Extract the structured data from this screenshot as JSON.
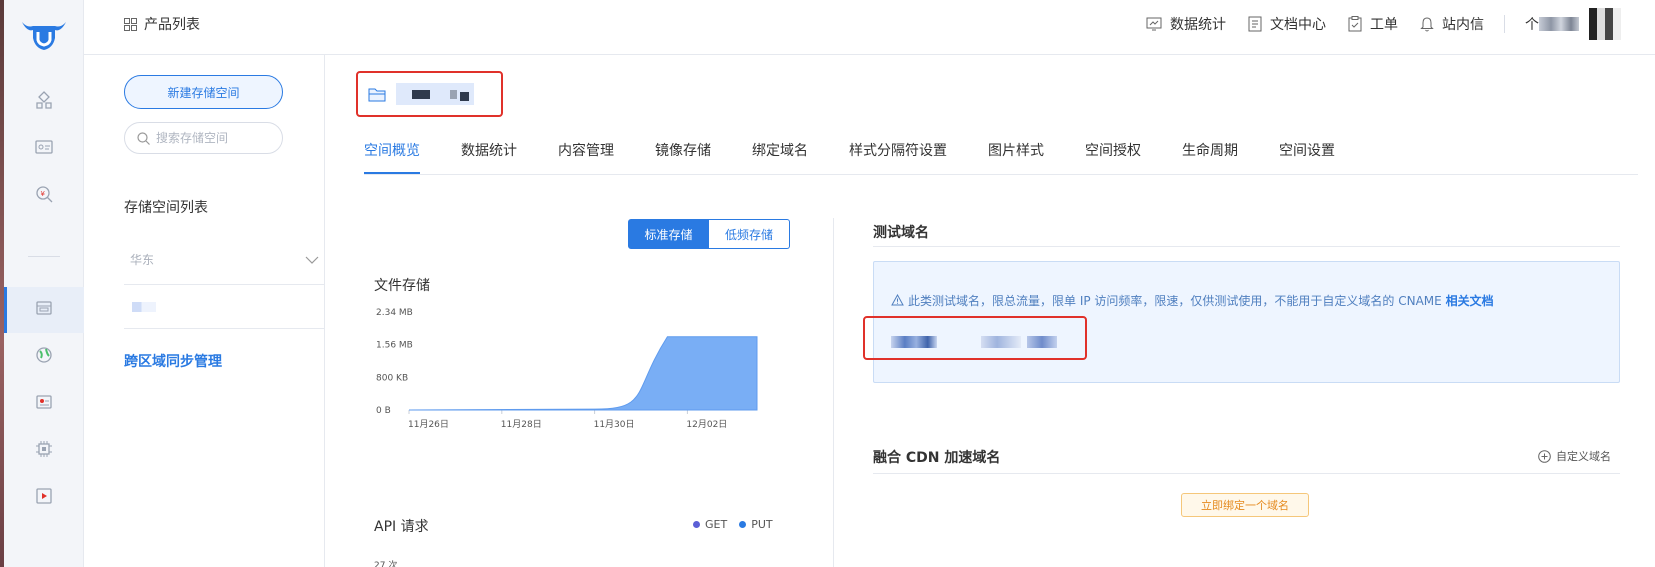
{
  "topbar": {
    "product_list": "产品列表",
    "nav": [
      {
        "label": "数据统计",
        "icon": "chart-icon"
      },
      {
        "label": "文档中心",
        "icon": "document-icon"
      },
      {
        "label": "工单",
        "icon": "clipboard-icon"
      },
      {
        "label": "站内信",
        "icon": "bell-icon"
      }
    ],
    "user_prefix": "个"
  },
  "sidebar": {
    "new_bucket_button": "新建存储空间",
    "search_placeholder": "搜索存储空间",
    "list_title": "存储空间列表",
    "region": "华东",
    "cross_region_sync": "跨区域同步管理"
  },
  "tabs": [
    {
      "label": "空间概览",
      "active": true
    },
    {
      "label": "数据统计",
      "active": false
    },
    {
      "label": "内容管理",
      "active": false
    },
    {
      "label": "镜像存储",
      "active": false
    },
    {
      "label": "绑定域名",
      "active": false
    },
    {
      "label": "样式分隔符设置",
      "active": false
    },
    {
      "label": "图片样式",
      "active": false
    },
    {
      "label": "空间授权",
      "active": false
    },
    {
      "label": "生命周期",
      "active": false
    },
    {
      "label": "空间设置",
      "active": false
    }
  ],
  "storage_toggle": {
    "standard": "标准存储",
    "infrequent": "低频存储",
    "selected": "standard"
  },
  "file_storage_title": "文件存储",
  "chart_data": {
    "type": "area",
    "title": "文件存储",
    "x": [
      "11月26日",
      "11月28日",
      "11月30日",
      "12月02日"
    ],
    "y_ticks": [
      "0 B",
      "800 KB",
      "1.56 MB",
      "2.34 MB"
    ],
    "ylim_bytes": [
      0,
      2453667
    ],
    "points": [
      {
        "x": "11月26日",
        "y_mb": 0
      },
      {
        "x": "11月28日",
        "y_mb": 0
      },
      {
        "x": "11月30日",
        "y_mb": 0.02
      },
      {
        "x": "12月01日",
        "y_mb": 0.55
      },
      {
        "x": "12月02日",
        "y_mb": 1.75
      },
      {
        "x": "12月03日",
        "y_mb": 1.75
      }
    ],
    "color": "#79aef5"
  },
  "api_title": "API 请求",
  "api_legend": [
    {
      "name": "GET",
      "color": "#5b5fd6"
    },
    {
      "name": "PUT",
      "color": "#2a7ae2"
    }
  ],
  "api_y_top": "27 次",
  "test_domain": {
    "title": "测试域名",
    "warning": "此类测试域名，限总流量，限单 IP 访问频率，限速，仅供测试使用，不能用于自定义域名的 CNAME",
    "doc_link": "相关文档"
  },
  "cdn": {
    "title": "融合 CDN 加速域名",
    "custom_domain": "自定义域名",
    "bind_button": "立即绑定一个域名"
  },
  "colors": {
    "accent": "#2a7ae2",
    "highlight_border": "#e0312a",
    "warning_orange": "#e58a1f"
  }
}
